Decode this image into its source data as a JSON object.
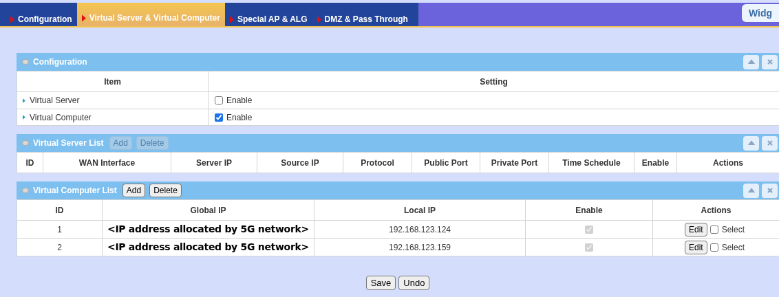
{
  "tabs": [
    {
      "label": "Configuration",
      "selected": false
    },
    {
      "label": "Virtual Server & Virtual Computer",
      "selected": true
    },
    {
      "label": "Special AP & ALG",
      "selected": false
    },
    {
      "label": "DMZ & Pass Through",
      "selected": false
    }
  ],
  "widget_button": "Widg",
  "configuration": {
    "title": "Configuration",
    "columns": [
      "Item",
      "Setting"
    ],
    "rows": [
      {
        "item": "Virtual Server",
        "label": "Enable",
        "checked": false
      },
      {
        "item": "Virtual Computer",
        "label": "Enable",
        "checked": true
      }
    ]
  },
  "virtual_server_list": {
    "title": "Virtual Server List",
    "buttons": [
      {
        "label": "Add",
        "disabled": true
      },
      {
        "label": "Delete",
        "disabled": true
      }
    ],
    "columns": [
      "ID",
      "WAN Interface",
      "Server IP",
      "Source IP",
      "Protocol",
      "Public Port",
      "Private Port",
      "Time Schedule",
      "Enable",
      "Actions"
    ]
  },
  "virtual_computer_list": {
    "title": "Virtual Computer List",
    "buttons": [
      {
        "label": "Add",
        "disabled": false
      },
      {
        "label": "Delete",
        "disabled": false
      }
    ],
    "columns": [
      "ID",
      "Global IP",
      "Local IP",
      "Enable",
      "Actions"
    ],
    "rows": [
      {
        "id": "1",
        "global_ip": "<IP address allocated by 5G network>",
        "local_ip": "192.168.123.124",
        "enabled": true,
        "edit": "Edit",
        "select_label": "Select",
        "selected": false
      },
      {
        "id": "2",
        "global_ip": "<IP address allocated by 5G network>",
        "local_ip": "192.168.123.159",
        "enabled": true,
        "edit": "Edit",
        "select_label": "Select",
        "selected": false
      }
    ]
  },
  "footer_buttons": [
    "Save",
    "Undo"
  ]
}
